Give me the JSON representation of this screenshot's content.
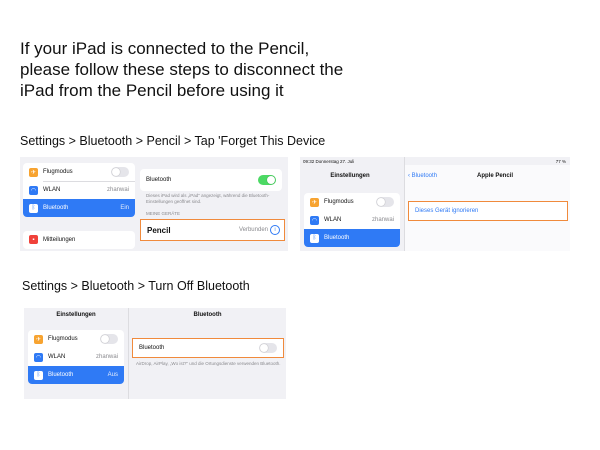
{
  "heading": {
    "line1": "If your iPad is connected to the Pencil,",
    "line2": "please follow these steps to disconnect the",
    "line3": "iPad from the Pencil before using it"
  },
  "caption1": "Settings > Bluetooth > Pencil > Tap 'Forget This Device",
  "caption2": "Settings > Bluetooth > Turn Off Bluetooth",
  "shot1": {
    "items": [
      {
        "label": "Flugmodus",
        "value": "",
        "icon": "airplane-icon",
        "color": "#f7a330"
      },
      {
        "label": "WLAN",
        "value": "zhanwai",
        "icon": "wifi-icon",
        "color": "#2f7af5"
      },
      {
        "label": "Bluetooth",
        "value": "Ein",
        "icon": "bluetooth-icon",
        "color": "#2f7af5"
      }
    ],
    "mitteilungen": "Mitteilungen",
    "bluetooth_label": "Bluetooth",
    "bluetooth_on": true,
    "description": "Dieses iPad wird als „iPad\" angezeigt, während die Bluetooth-Einstellungen geöffnet sind.",
    "section": "MEINE GERÄTE",
    "device_name": "Pencil",
    "device_status": "Verbunden"
  },
  "shot2": {
    "time": "09:32  Donnerstag 27. Juli",
    "battery": "77 %",
    "left_title": "Einstellungen",
    "back": "Bluetooth",
    "right_title": "Apple Pencil",
    "items": [
      {
        "label": "Flugmodus",
        "value": ""
      },
      {
        "label": "WLAN",
        "value": "zhanwai"
      },
      {
        "label": "Bluetooth",
        "value": ""
      }
    ],
    "forget": "Dieses Gerät ignorieren"
  },
  "shot3": {
    "left_title": "Einstellungen",
    "right_title": "Bluetooth",
    "items": [
      {
        "label": "Flugmodus",
        "value": ""
      },
      {
        "label": "WLAN",
        "value": "zhanwai"
      },
      {
        "label": "Bluetooth",
        "value": "Aus"
      }
    ],
    "bluetooth_label": "Bluetooth",
    "bluetooth_on": false,
    "description": "AirDrop, AirPlay, „Wo ist?\" und die Ortungsdienste verwenden Bluetooth."
  },
  "colors": {
    "accent": "#2f7af5",
    "highlight": "#f08a3c",
    "toggle_on": "#4cd964",
    "airplane": "#f7a330",
    "notifications": "#f0413a"
  }
}
